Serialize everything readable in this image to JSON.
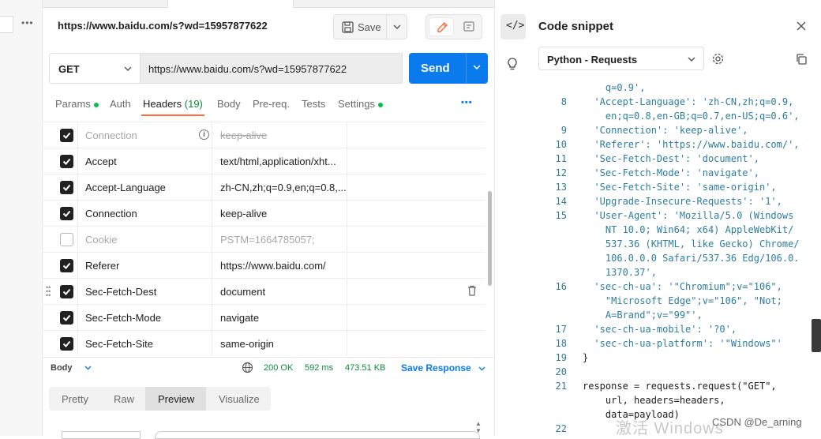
{
  "request": {
    "title_url": "https://www.baidu.com/s?wd=15957877622",
    "save_label": "Save",
    "method": "GET",
    "url": "https://www.baidu.com/s?wd=15957877622",
    "send_label": "Send"
  },
  "tabs": {
    "params": "Params",
    "auth": "Auth",
    "headers": "Headers",
    "headers_count": "(19)",
    "body": "Body",
    "prereq": "Pre-req.",
    "tests": "Tests",
    "settings": "Settings"
  },
  "headers": [
    {
      "key": "Connection",
      "value": "keep-alive",
      "checked": true,
      "disabled": true
    },
    {
      "key": "Accept",
      "value": "text/html,application/xht...",
      "checked": true
    },
    {
      "key": "Accept-Language",
      "value": "zh-CN,zh;q=0.9,en;q=0.8,...",
      "checked": true
    },
    {
      "key": "Connection",
      "value": "keep-alive",
      "checked": true
    },
    {
      "key": "Cookie",
      "value": "PSTM=1664785057;",
      "checked": false,
      "disabled": true
    },
    {
      "key": "Referer",
      "value": "https://www.baidu.com/",
      "checked": true
    },
    {
      "key": "Sec-Fetch-Dest",
      "value": "document",
      "checked": true
    },
    {
      "key": "Sec-Fetch-Mode",
      "value": "navigate",
      "checked": true
    },
    {
      "key": "Sec-Fetch-Site",
      "value": "same-origin",
      "checked": true
    }
  ],
  "status": {
    "body_label": "Body",
    "code": "200 OK",
    "time": "592 ms",
    "size": "473.51 KB",
    "save_response": "Save Response"
  },
  "preview_tabs": [
    "Pretty",
    "Raw",
    "Preview",
    "Visualize"
  ],
  "snippet": {
    "title": "Code snippet",
    "language": "Python - Requests",
    "lines": [
      {
        "n": "",
        "t": "    q=0.9',"
      },
      {
        "n": "8",
        "t": "  'Accept-Language': 'zh-CN,zh;q=0.9,"
      },
      {
        "n": "",
        "t": "    en;q=0.8,en-GB;q=0.7,en-US;q=0.6',"
      },
      {
        "n": "9",
        "t": "  'Connection': 'keep-alive',"
      },
      {
        "n": "10",
        "t": "  'Referer': 'https://www.baidu.com/',"
      },
      {
        "n": "11",
        "t": "  'Sec-Fetch-Dest': 'document',"
      },
      {
        "n": "12",
        "t": "  'Sec-Fetch-Mode': 'navigate',"
      },
      {
        "n": "13",
        "t": "  'Sec-Fetch-Site': 'same-origin',"
      },
      {
        "n": "14",
        "t": "  'Upgrade-Insecure-Requests': '1',"
      },
      {
        "n": "15",
        "t": "  'User-Agent': 'Mozilla/5.0 (Windows"
      },
      {
        "n": "",
        "t": "    NT 10.0; Win64; x64) AppleWebKit/"
      },
      {
        "n": "",
        "t": "    537.36 (KHTML, like Gecko) Chrome/"
      },
      {
        "n": "",
        "t": "    106.0.0.0 Safari/537.36 Edg/106.0."
      },
      {
        "n": "",
        "t": "    1370.37',"
      },
      {
        "n": "16",
        "t": "  'sec-ch-ua': '\"Chromium\";v=\"106\","
      },
      {
        "n": "",
        "t": "    \"Microsoft Edge\";v=\"106\", \"Not;"
      },
      {
        "n": "",
        "t": "    A=Brand\";v=\"99\"',"
      },
      {
        "n": "17",
        "t": "  'sec-ch-ua-mobile': '?0',"
      },
      {
        "n": "18",
        "t": "  'sec-ch-ua-platform': '\"Windows\"'"
      },
      {
        "n": "19",
        "t": "}"
      },
      {
        "n": "20",
        "t": ""
      },
      {
        "n": "21",
        "t": "response = requests.request(\"GET\","
      },
      {
        "n": "",
        "t": "    url, headers=headers,"
      },
      {
        "n": "",
        "t": "    data=payload)"
      },
      {
        "n": "22",
        "t": ""
      }
    ]
  },
  "overlay": {
    "watermark": "激活 Windows",
    "credit": "CSDN @De_arning"
  },
  "colors": {
    "accent": "#097bed",
    "active_tab": "#ff6c37",
    "ok_green": "#0f8a3a"
  }
}
